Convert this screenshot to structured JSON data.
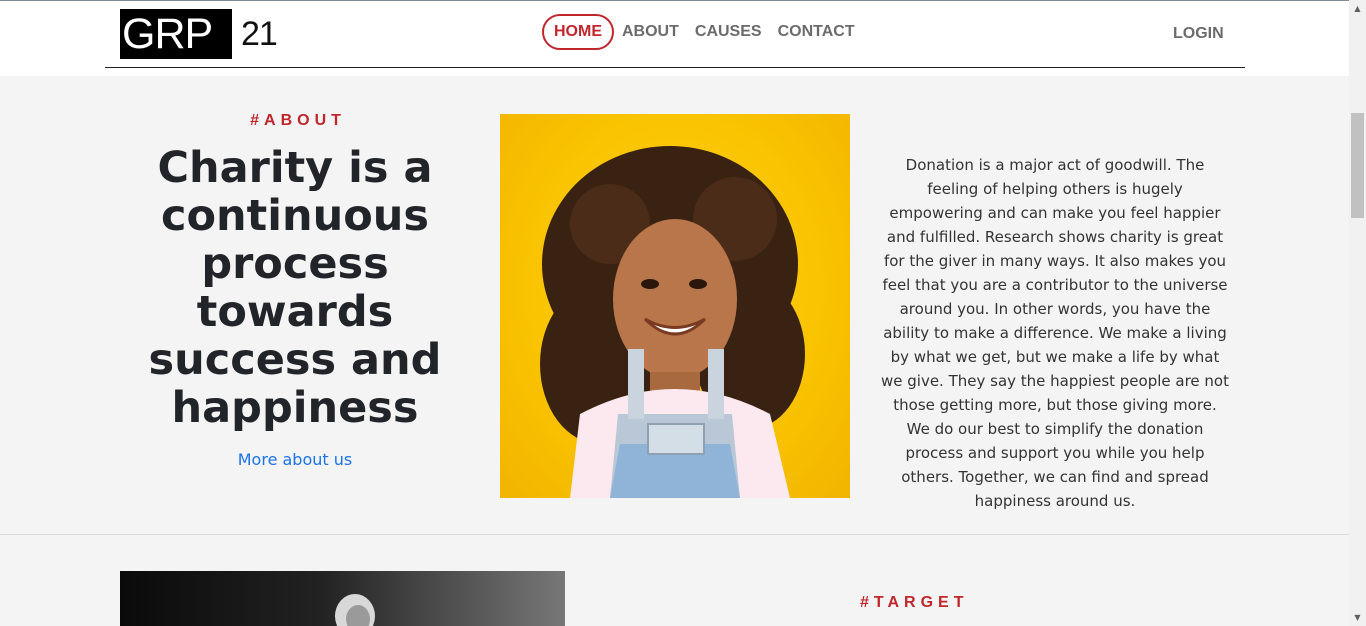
{
  "header": {
    "logo_text": "GRP",
    "logo_number": "21",
    "nav": [
      "HOME",
      "ABOUT",
      "CAUSES",
      "CONTACT"
    ],
    "active_nav": "HOME",
    "login_label": "LOGIN"
  },
  "about": {
    "eyebrow": "#ABOUT",
    "headline": "Charity is a continuous process towards success and happiness",
    "link_label": "More about us",
    "body": "Donation is a major act of goodwill. The feeling of helping others is hugely empowering and can make you feel happier and fulfilled. Research shows charity is great for the giver in many ways. It also makes you feel that you are a contributor to the universe around you. In other words, you have the ability to make a difference. We make a living by what we get, but we make a life by what we give. They say the happiest people are not those getting more, but those giving more. We do our best to simplify the donation process and support you while you help others. Together, we can find and spread happiness around us."
  },
  "target": {
    "eyebrow": "#TARGET"
  },
  "colors": {
    "accent": "#c0262c",
    "link": "#1a73e8",
    "nav_text": "#6b6b6b",
    "page_bg": "#f4f4f4"
  },
  "icons": {
    "scroll_up": "triangle-up-icon",
    "scroll_down": "triangle-down-icon"
  }
}
